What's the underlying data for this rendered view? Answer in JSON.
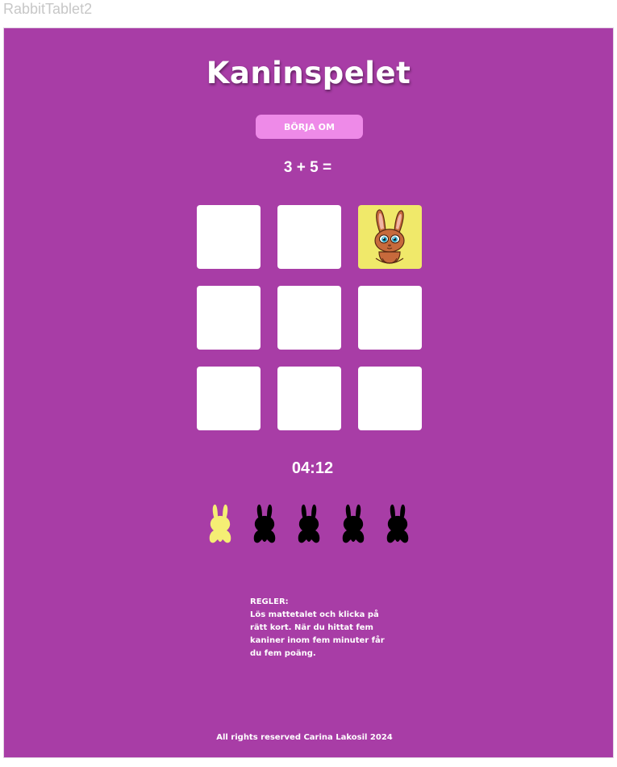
{
  "window": {
    "title": "RabbitTablet2"
  },
  "game": {
    "title": "Kaninspelet",
    "restart_label": "BÖRJA OM",
    "question": "3 + 5 =",
    "timer": "04:12",
    "cards": [
      {
        "state": "hidden"
      },
      {
        "state": "hidden"
      },
      {
        "state": "revealed",
        "icon": "rabbit-character-icon"
      },
      {
        "state": "hidden"
      },
      {
        "state": "hidden"
      },
      {
        "state": "hidden"
      },
      {
        "state": "hidden"
      },
      {
        "state": "hidden"
      },
      {
        "state": "hidden"
      }
    ],
    "rabbits_found": 1,
    "rabbits_total": 5
  },
  "rules": {
    "heading": "REGLER:",
    "text": "Lös mattetalet och klicka på rätt kort. När du hittat fem kaniner inom fem minuter får du fem poäng."
  },
  "footer": {
    "text": "All rights reserved Carina Lakosil 2024"
  },
  "colors": {
    "background": "#a83da6",
    "button": "#ee8ae8",
    "card": "#ffffff",
    "card_revealed": "#f0e96a",
    "rabbit_found": "#f5ee74",
    "rabbit_missing": "#000000"
  }
}
